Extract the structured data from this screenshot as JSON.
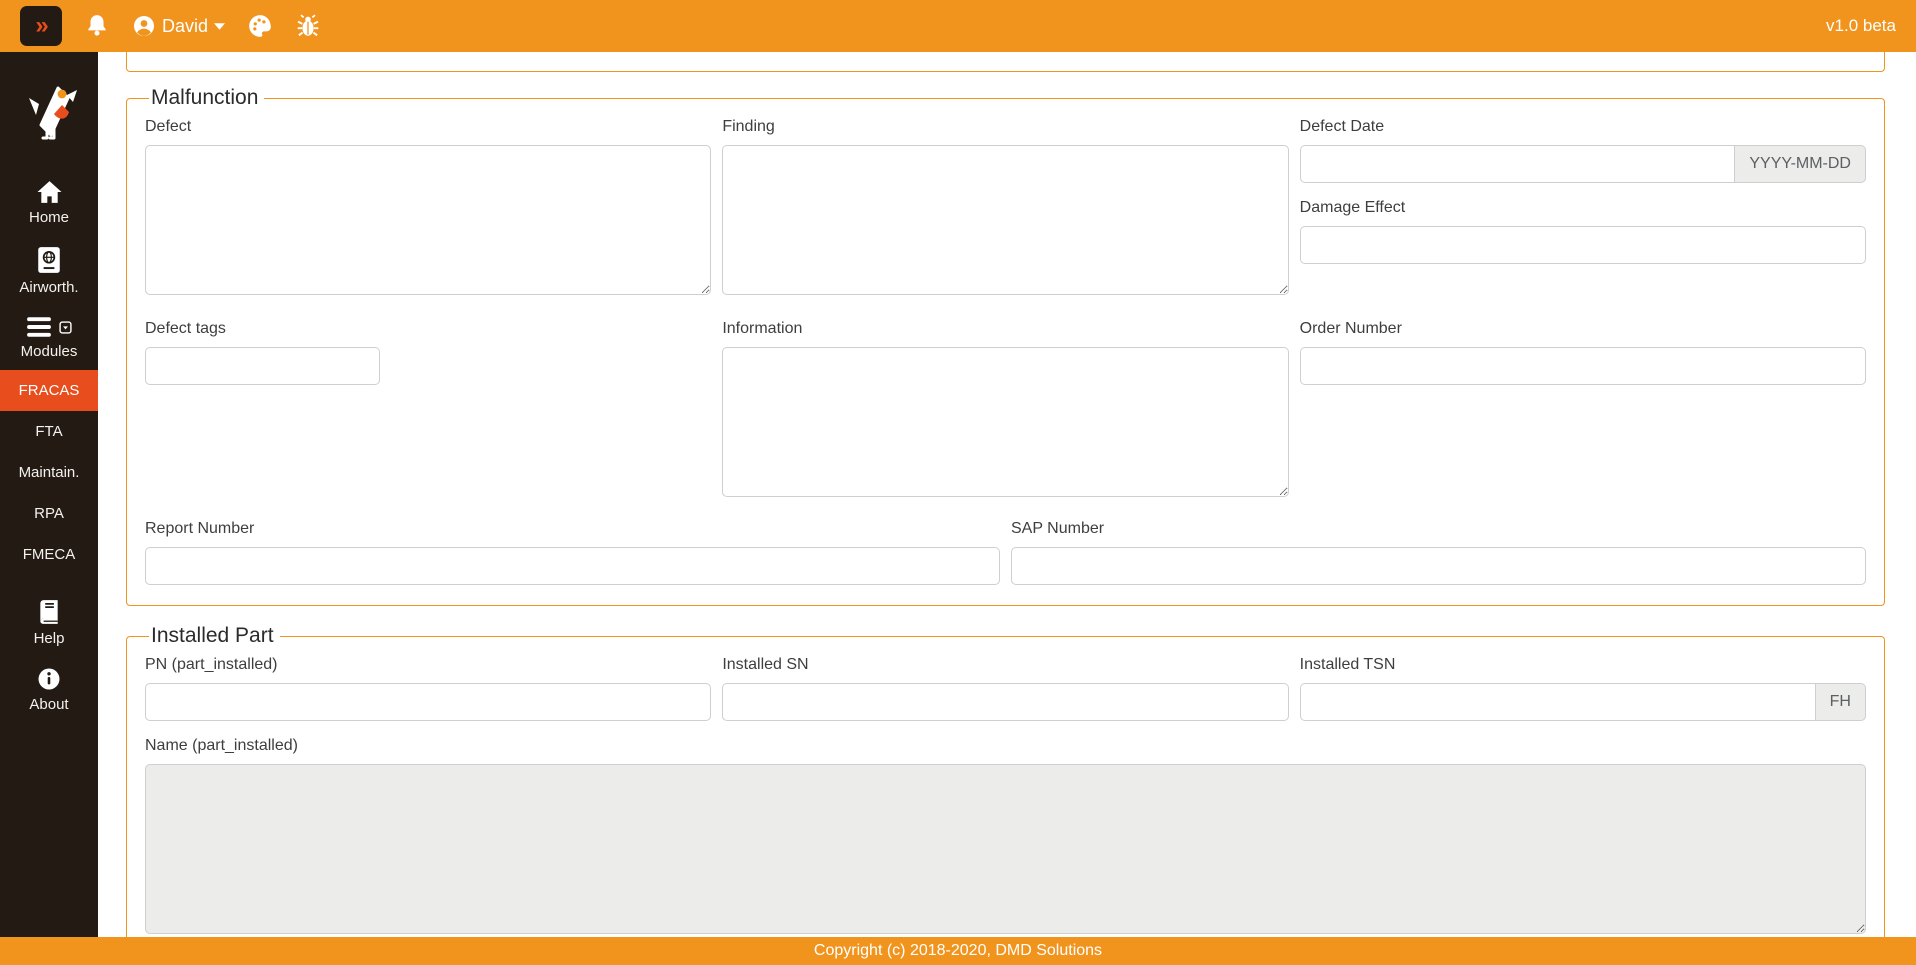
{
  "topbar": {
    "collapse_label": "»",
    "user": "David",
    "version": "v1.0 beta"
  },
  "sidebar": {
    "items": [
      {
        "label": "Home",
        "icon": "home"
      },
      {
        "label": "Airworth.",
        "icon": "passport"
      },
      {
        "label": "Modules",
        "icon": "bars"
      },
      {
        "label": "FRACAS",
        "active": true
      },
      {
        "label": "FTA"
      },
      {
        "label": "Maintain."
      },
      {
        "label": "RPA"
      },
      {
        "label": "FMECA"
      },
      {
        "label": "Help",
        "icon": "book"
      },
      {
        "label": "About",
        "icon": "info-circle"
      }
    ]
  },
  "malfunction": {
    "legend": "Malfunction",
    "defect_label": "Defect",
    "finding_label": "Finding",
    "defect_date_label": "Defect Date",
    "defect_date_suffix": "YYYY-MM-DD",
    "damage_effect_label": "Damage Effect",
    "defect_tags_label": "Defect tags",
    "information_label": "Information",
    "order_number_label": "Order Number",
    "report_number_label": "Report Number",
    "sap_number_label": "SAP Number"
  },
  "installed_part": {
    "legend": "Installed Part",
    "pn_label": "PN (part_installed)",
    "sn_label": "Installed SN",
    "tsn_label": "Installed TSN",
    "tsn_suffix": "FH",
    "name_label": "Name (part_installed)"
  },
  "footer": {
    "copyright": "Copyright (c) 2018-2020, DMD Solutions"
  },
  "colors": {
    "accent_orange": "#F0941E",
    "accent_red_orange": "#E84E1D",
    "sidebar_bg": "#221A13",
    "disabled_bg": "#ECECEA"
  }
}
